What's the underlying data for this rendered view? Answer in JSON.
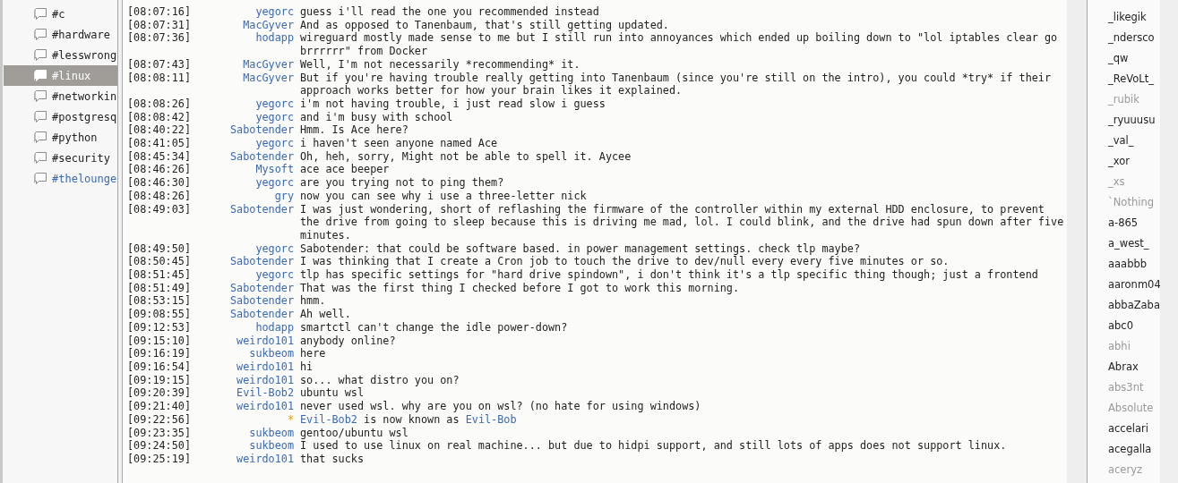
{
  "channels": [
    {
      "name": "#c",
      "selected": false,
      "highlighted": false
    },
    {
      "name": "#hardware",
      "selected": false,
      "highlighted": false
    },
    {
      "name": "#lesswrong",
      "selected": false,
      "highlighted": false
    },
    {
      "name": "#linux",
      "selected": true,
      "highlighted": false
    },
    {
      "name": "#networkin",
      "selected": false,
      "highlighted": false
    },
    {
      "name": "#postgresq",
      "selected": false,
      "highlighted": false
    },
    {
      "name": "#python",
      "selected": false,
      "highlighted": false
    },
    {
      "name": "#security",
      "selected": false,
      "highlighted": false
    },
    {
      "name": "#thelounge",
      "selected": false,
      "highlighted": true
    }
  ],
  "messages": [
    {
      "kind": "message",
      "time": "[08:07:16]",
      "nick": "yegorc",
      "text": "guess i'll read the one you recommended instead"
    },
    {
      "kind": "message",
      "time": "[08:07:31]",
      "nick": "MacGyver",
      "text": "And as opposed to Tanenbaum, that's still getting updated."
    },
    {
      "kind": "message",
      "time": "[08:07:36]",
      "nick": "hodapp",
      "text": "wireguard mostly made sense to me but I still run into annoyances which ended up boiling down to \"lol iptables clear go brrrrrr\" from Docker"
    },
    {
      "kind": "message",
      "time": "[08:07:43]",
      "nick": "MacGyver",
      "text": "Well, I'm not necessarily *recommending* it."
    },
    {
      "kind": "message",
      "time": "[08:08:11]",
      "nick": "MacGyver",
      "text": "But if you're having trouble really getting into Tanenbaum (since you're still on the intro), you could *try* if their approach works better for how your brain likes it explained."
    },
    {
      "kind": "message",
      "time": "[08:08:26]",
      "nick": "yegorc",
      "text": "i'm not having trouble, i just read slow i guess"
    },
    {
      "kind": "message",
      "time": "[08:08:42]",
      "nick": "yegorc",
      "text": "and i'm busy with school"
    },
    {
      "kind": "message",
      "time": "[08:40:22]",
      "nick": "Sabotender",
      "text": "Hmm. Is Ace here?"
    },
    {
      "kind": "message",
      "time": "[08:41:05]",
      "nick": "yegorc",
      "text": "i haven't seen anyone named Ace"
    },
    {
      "kind": "message",
      "time": "[08:45:34]",
      "nick": "Sabotender",
      "text": "Oh, heh, sorry, Might not be able to spell it. Aycee"
    },
    {
      "kind": "message",
      "time": "[08:46:26]",
      "nick": "Mysoft",
      "text": "ace ace beeper"
    },
    {
      "kind": "message",
      "time": "[08:46:30]",
      "nick": "yegorc",
      "text": "are you trying not to ping them?"
    },
    {
      "kind": "message",
      "time": "[08:48:26]",
      "nick": "gry",
      "text": "now you can see why i use a three-letter nick"
    },
    {
      "kind": "message",
      "time": "[08:49:03]",
      "nick": "Sabotender",
      "text": "I was just wondering, short of reflashing the firmware of the controller within my external HDD enclosure, to prevent the drive from going to sleep because this is driving me mad, lol. I could blink, and the drive had spun down after five  minutes."
    },
    {
      "kind": "message",
      "time": "[08:49:50]",
      "nick": "yegorc",
      "text": "Sabotender: that could be software based. in power management settings. check tlp maybe?"
    },
    {
      "kind": "message",
      "time": "[08:50:45]",
      "nick": "Sabotender",
      "text": "I was thinking that I create a Cron job to touch the drive to dev/null every every five minutes or so."
    },
    {
      "kind": "message",
      "time": "[08:51:45]",
      "nick": "yegorc",
      "text": "tlp has specific settings for \"hard drive spindown\", i don't think it's a tlp specific thing though; just a frontend"
    },
    {
      "kind": "message",
      "time": "[08:51:49]",
      "nick": "Sabotender",
      "text": "That was the first thing I checked before I got to work this morning."
    },
    {
      "kind": "message",
      "time": "[08:53:15]",
      "nick": "Sabotender",
      "text": "hmm."
    },
    {
      "kind": "message",
      "time": "[09:08:55]",
      "nick": "Sabotender",
      "text": "Ah well."
    },
    {
      "kind": "message",
      "time": "[09:12:53]",
      "nick": "hodapp",
      "text": "smartctl can't change the idle power-down?"
    },
    {
      "kind": "message",
      "time": "[09:15:10]",
      "nick": "weirdo101",
      "text": "anybody online?"
    },
    {
      "kind": "message",
      "time": "[09:16:19]",
      "nick": "sukbeom",
      "text": "here"
    },
    {
      "kind": "message",
      "time": "[09:16:54]",
      "nick": "weirdo101",
      "text": "hi"
    },
    {
      "kind": "message",
      "time": "[09:19:15]",
      "nick": "weirdo101",
      "text": "so... what distro you on?"
    },
    {
      "kind": "message",
      "time": "[09:20:39]",
      "nick": "Evil-Bob2",
      "text": "ubuntu wsl"
    },
    {
      "kind": "message",
      "time": "[09:21:40]",
      "nick": "weirdo101",
      "text": "never used wsl. why are you on wsl? (no hate for using windows)"
    },
    {
      "kind": "system",
      "time": "[09:22:56]",
      "nick": "*",
      "segments": [
        {
          "kind": "nick",
          "text": "Evil-Bob2"
        },
        {
          "kind": "plain",
          "text": " is now known as "
        },
        {
          "kind": "nick",
          "text": "Evil-Bob"
        }
      ]
    },
    {
      "kind": "message",
      "time": "[09:23:35]",
      "nick": "sukbeom",
      "text": "gentoo/ubuntu wsl"
    },
    {
      "kind": "message",
      "time": "[09:24:50]",
      "nick": "sukbeom",
      "text": "I used to use linux on real machine... but due to hidpi support, and still lots of apps does not support linux."
    },
    {
      "kind": "message",
      "time": "[09:25:19]",
      "nick": "weirdo101",
      "text": "that sucks"
    }
  ],
  "users": [
    {
      "name": "_likegik",
      "away": false
    },
    {
      "name": "_ndersco",
      "away": false
    },
    {
      "name": "_qw",
      "away": false
    },
    {
      "name": "_ReVoLt_",
      "away": false
    },
    {
      "name": "_rubik",
      "away": true
    },
    {
      "name": "_ryuuusu",
      "away": false
    },
    {
      "name": "_val_",
      "away": false
    },
    {
      "name": "_xor",
      "away": false
    },
    {
      "name": "_xs",
      "away": true
    },
    {
      "name": "`Nothing",
      "away": true
    },
    {
      "name": "a-865",
      "away": false
    },
    {
      "name": "a_west_",
      "away": false
    },
    {
      "name": "aaabbb",
      "away": false
    },
    {
      "name": "aaronm04",
      "away": false
    },
    {
      "name": "abbaZaba",
      "away": false
    },
    {
      "name": "abc0",
      "away": false
    },
    {
      "name": "abhi",
      "away": true
    },
    {
      "name": "Abrax",
      "away": false
    },
    {
      "name": "abs3nt",
      "away": true
    },
    {
      "name": "Absolute",
      "away": true
    },
    {
      "name": "accelari",
      "away": false
    },
    {
      "name": "acegalla",
      "away": false
    },
    {
      "name": "aceryz",
      "away": true
    }
  ]
}
